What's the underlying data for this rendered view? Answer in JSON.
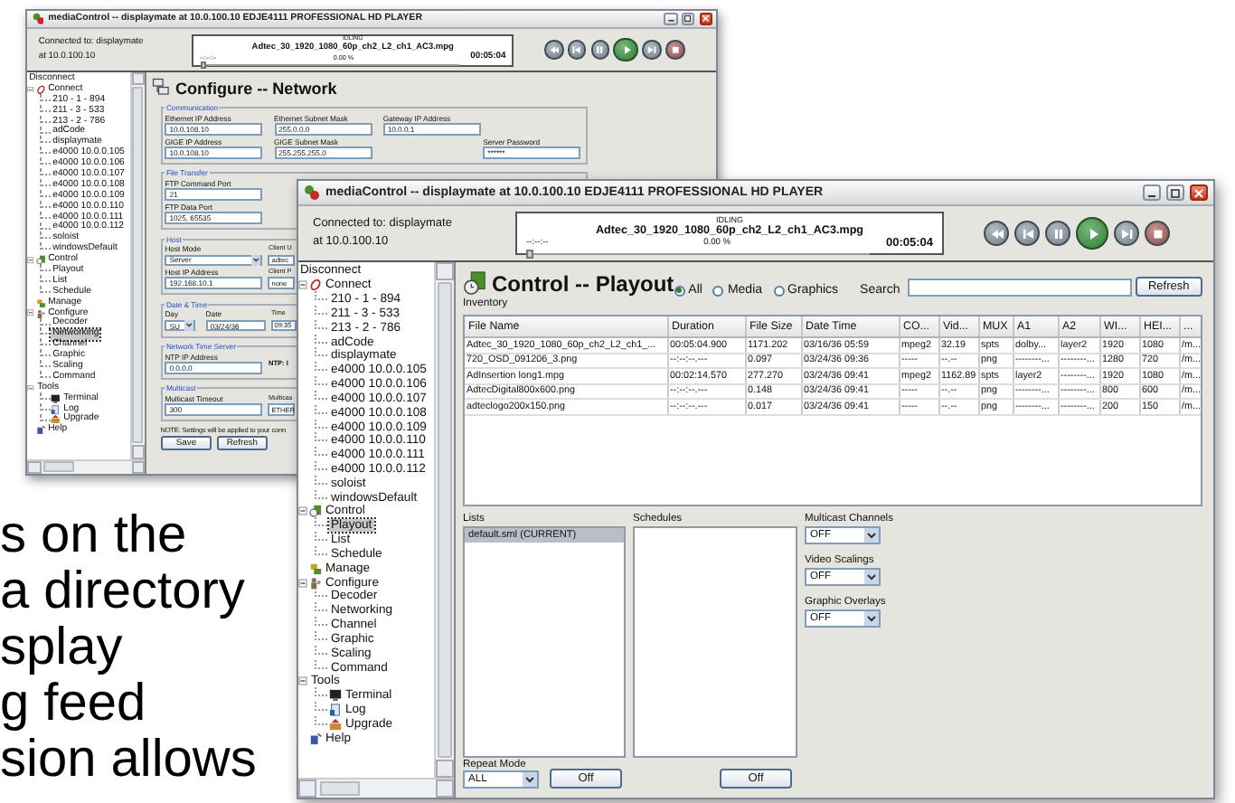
{
  "back_window": {
    "title": "mediaControl -- displaymate at 10.0.100.10 EDJE4111 PROFESSIONAL HD PLAYER",
    "connection": [
      "Connected to: displaymate",
      "at 10.0.100.10"
    ],
    "player": {
      "status": "IDLING",
      "file": "Adtec_30_1920_1080_60p_ch2_L2_ch1_AC3.mpg",
      "percent": "0.00 %",
      "position": "--:--:--",
      "duration": "00:05:04",
      "level": 0
    },
    "tree": [
      {
        "label": "Disconnect",
        "kind": "plain",
        "selected": false
      },
      {
        "label": "Connect",
        "kind": "link",
        "expanded": true,
        "selected": false,
        "children": [
          {
            "label": "210 - 1 - 894",
            "kind": "leaf",
            "selected": false
          },
          {
            "label": "211 - 3 - 533",
            "kind": "leaf",
            "selected": false
          },
          {
            "label": "213 - 2 - 786",
            "kind": "leaf",
            "selected": false
          },
          {
            "label": "adCode",
            "kind": "leaf",
            "selected": false
          },
          {
            "label": "displaymate",
            "kind": "leaf",
            "selected": false
          },
          {
            "label": "e4000 10.0.0.105",
            "kind": "leaf",
            "selected": false
          },
          {
            "label": "e4000 10.0.0.106",
            "kind": "leaf",
            "selected": false
          },
          {
            "label": "e4000 10.0.0.107",
            "kind": "leaf",
            "selected": false
          },
          {
            "label": "e4000 10.0.0.108",
            "kind": "leaf",
            "selected": false
          },
          {
            "label": "e4000 10.0.0.109",
            "kind": "leaf",
            "selected": false
          },
          {
            "label": "e4000 10.0.0.110",
            "kind": "leaf",
            "selected": false
          },
          {
            "label": "e4000 10.0.0.111",
            "kind": "leaf",
            "selected": false
          },
          {
            "label": "e4000 10.0.0.112",
            "kind": "leaf",
            "selected": false
          },
          {
            "label": "soloist",
            "kind": "leaf",
            "selected": false
          },
          {
            "label": "windowsDefault",
            "kind": "leaf",
            "selected": false
          }
        ]
      },
      {
        "label": "Control",
        "kind": "control",
        "expanded": true,
        "selected": false,
        "children": [
          {
            "label": "Playout",
            "kind": "leaf",
            "selected": false
          },
          {
            "label": "List",
            "kind": "leaf",
            "selected": false
          },
          {
            "label": "Schedule",
            "kind": "leaf",
            "selected": false
          }
        ]
      },
      {
        "label": "Manage",
        "kind": "manage",
        "selected": false
      },
      {
        "label": "Configure",
        "kind": "configure",
        "expanded": true,
        "selected": false,
        "children": [
          {
            "label": "Decoder",
            "kind": "leaf",
            "selected": false
          },
          {
            "label": "Networking",
            "kind": "leaf",
            "selected": true
          },
          {
            "label": "Channel",
            "kind": "leaf",
            "selected": false
          },
          {
            "label": "Graphic",
            "kind": "leaf",
            "selected": false
          },
          {
            "label": "Scaling",
            "kind": "leaf",
            "selected": false
          },
          {
            "label": "Command",
            "kind": "leaf",
            "selected": false
          }
        ]
      },
      {
        "label": "Tools",
        "kind": "folder",
        "expanded": true,
        "selected": false,
        "children": [
          {
            "label": "Terminal",
            "kind": "terminal",
            "selected": false
          },
          {
            "label": "Log",
            "kind": "log",
            "selected": false
          },
          {
            "label": "Upgrade",
            "kind": "upgrade",
            "selected": false
          }
        ]
      },
      {
        "label": "Help",
        "kind": "help",
        "selected": false
      }
    ],
    "panel": {
      "kind": "network",
      "title": "Configure -- Network",
      "groups": [
        {
          "legend": "Communication",
          "rows": [
            [
              {
                "label": "Ethernet IP Address",
                "value": "10.0.108.10",
                "kind": "text"
              },
              {
                "label": "Ethernet Subnet Mask",
                "value": "255.0.0.0",
                "kind": "text"
              },
              {
                "label": "Gateway IP Address",
                "value": "10.0.0.1",
                "kind": "text"
              }
            ],
            [
              {
                "label": "GIGE IP Address",
                "value": "10.0.108.10",
                "kind": "text"
              },
              {
                "label": "GIGE Subnet Mask",
                "value": "255.255.255.0",
                "kind": "text"
              },
              {
                "label": "Server Password",
                "value": "******",
                "kind": "password"
              }
            ]
          ]
        },
        {
          "legend": "File Transfer",
          "rows": [
            [
              {
                "label": "FTP Command Port",
                "value": "21",
                "kind": "text"
              }
            ],
            [
              {
                "label": "FTP Data Port",
                "value": "1025, 65535",
                "kind": "text"
              }
            ]
          ]
        },
        {
          "legend": "Host",
          "rows": [
            [
              {
                "label": "Host Mode",
                "value": "Server",
                "kind": "combo"
              },
              {
                "label": "Client U",
                "value": "adtec",
                "kind": "partial"
              }
            ],
            [
              {
                "label": "Host IP Address",
                "value": "192.168.10.1",
                "kind": "text"
              },
              {
                "label": "Client P",
                "value": "none",
                "kind": "partial"
              }
            ]
          ]
        },
        {
          "legend": "Date & Time",
          "rows": [
            [
              {
                "label": "Day",
                "value": "SU",
                "kind": "small-combo"
              },
              {
                "label": "Date",
                "value": "03/24/36",
                "kind": "date"
              },
              {
                "label": "Time",
                "value": "09:35",
                "kind": "partial"
              }
            ]
          ]
        },
        {
          "legend": "Network Time Server",
          "rows": [
            [
              {
                "label": "NTP IP Address",
                "value": "0.0.0.0",
                "kind": "text"
              },
              {
                "label": "NTP: I",
                "kind": "heading"
              }
            ]
          ]
        },
        {
          "legend": "Multicast",
          "rows": [
            [
              {
                "label": "Multicast Timeout",
                "value": "300",
                "kind": "text"
              },
              {
                "label": "Multicas",
                "value": "ETHER",
                "kind": "partial"
              }
            ]
          ]
        }
      ],
      "note": "NOTE: Settings will be applied to your conn",
      "buttons": [
        "Save",
        "Refresh"
      ]
    }
  },
  "front_window": {
    "title": "mediaControl -- displaymate at 10.0.100.10 EDJE4111 PROFESSIONAL HD PLAYER",
    "connection": [
      "Connected to: displaymate",
      "at 10.0.100.10"
    ],
    "player": {
      "status": "IDLING",
      "file": "Adtec_30_1920_1080_60p_ch2_L2_ch1_AC3.mpg",
      "percent": "0.00 %",
      "position": "--:--:--",
      "duration": "00:05:04",
      "level": 0
    },
    "tree": [
      {
        "label": "Disconnect",
        "kind": "plain",
        "selected": false
      },
      {
        "label": "Connect",
        "kind": "link",
        "expanded": true,
        "selected": false,
        "children": [
          {
            "label": "210 - 1 - 894",
            "kind": "leaf",
            "selected": false
          },
          {
            "label": "211 - 3 - 533",
            "kind": "leaf",
            "selected": false
          },
          {
            "label": "213 - 2 - 786",
            "kind": "leaf",
            "selected": false
          },
          {
            "label": "adCode",
            "kind": "leaf",
            "selected": false
          },
          {
            "label": "displaymate",
            "kind": "leaf",
            "selected": false
          },
          {
            "label": "e4000 10.0.0.105",
            "kind": "leaf",
            "selected": false
          },
          {
            "label": "e4000 10.0.0.106",
            "kind": "leaf",
            "selected": false
          },
          {
            "label": "e4000 10.0.0.107",
            "kind": "leaf",
            "selected": false
          },
          {
            "label": "e4000 10.0.0.108",
            "kind": "leaf",
            "selected": false
          },
          {
            "label": "e4000 10.0.0.109",
            "kind": "leaf",
            "selected": false
          },
          {
            "label": "e4000 10.0.0.110",
            "kind": "leaf",
            "selected": false
          },
          {
            "label": "e4000 10.0.0.111",
            "kind": "leaf",
            "selected": false
          },
          {
            "label": "e4000 10.0.0.112",
            "kind": "leaf",
            "selected": false
          },
          {
            "label": "soloist",
            "kind": "leaf",
            "selected": false
          },
          {
            "label": "windowsDefault",
            "kind": "leaf",
            "selected": false
          }
        ]
      },
      {
        "label": "Control",
        "kind": "control",
        "expanded": true,
        "selected": false,
        "children": [
          {
            "label": "Playout",
            "kind": "leaf",
            "selected": true
          },
          {
            "label": "List",
            "kind": "leaf",
            "selected": false
          },
          {
            "label": "Schedule",
            "kind": "leaf",
            "selected": false
          }
        ]
      },
      {
        "label": "Manage",
        "kind": "manage",
        "selected": false
      },
      {
        "label": "Configure",
        "kind": "configure",
        "expanded": true,
        "selected": false,
        "children": [
          {
            "label": "Decoder",
            "kind": "leaf",
            "selected": false
          },
          {
            "label": "Networking",
            "kind": "leaf",
            "selected": false
          },
          {
            "label": "Channel",
            "kind": "leaf",
            "selected": false
          },
          {
            "label": "Graphic",
            "kind": "leaf",
            "selected": false
          },
          {
            "label": "Scaling",
            "kind": "leaf",
            "selected": false
          },
          {
            "label": "Command",
            "kind": "leaf",
            "selected": false
          }
        ]
      },
      {
        "label": "Tools",
        "kind": "folder",
        "expanded": true,
        "selected": false,
        "children": [
          {
            "label": "Terminal",
            "kind": "terminal",
            "selected": false
          },
          {
            "label": "Log",
            "kind": "log",
            "selected": false
          },
          {
            "label": "Upgrade",
            "kind": "upgrade",
            "selected": false
          }
        ]
      },
      {
        "label": "Help",
        "kind": "help",
        "selected": false
      }
    ],
    "panel": {
      "kind": "playout",
      "title": "Control -- Playout",
      "inventory_label": "Inventory",
      "filters": [
        {
          "label": "All",
          "selected": true
        },
        {
          "label": "Media",
          "selected": false
        },
        {
          "label": "Graphics",
          "selected": false
        }
      ],
      "search": {
        "label": "Search"
      },
      "refresh": "Refresh",
      "table": {
        "columns": [
          "File Name",
          "Duration",
          "File Size",
          "Date Time",
          "CO...",
          "Vid...",
          "MUX",
          "A1",
          "A2",
          "WI...",
          "HEI...",
          "..."
        ],
        "rows": [
          [
            "Adtec_30_1920_1080_60p_ch2_L2_ch1_...",
            "00:05:04.900",
            "1171.202",
            "03/16/36 05:59",
            "mpeg2",
            "32.19",
            "spts",
            "dolby...",
            "layer2",
            "1920",
            "1080",
            "/m..."
          ],
          [
            "720_OSD_091206_3.png",
            "--:--:--.---",
            "0.097",
            "03/24/36 09:36",
            "-----",
            "--.--",
            "png",
            "--------...",
            "--------...",
            "1280",
            "720",
            "/m..."
          ],
          [
            "AdInsertion long1.mpg",
            "00:02:14.570",
            "277.270",
            "03/24/36 09:41",
            "mpeg2",
            "1162.89",
            "spts",
            "layer2",
            "--------...",
            "1920",
            "1080",
            "/m..."
          ],
          [
            "AdtecDigital800x600.png",
            "--:--:--.---",
            "0.148",
            "03/24/36 09:41",
            "-----",
            "--.--",
            "png",
            "--------...",
            "--------...",
            "800",
            "600",
            "/m..."
          ],
          [
            "adteclogo200x150.png",
            "--:--:--.---",
            "0.017",
            "03/24/36 09:41",
            "-----",
            "--.--",
            "png",
            "--------...",
            "--------...",
            "200",
            "150",
            "/m..."
          ]
        ]
      },
      "lists": {
        "label": "Lists",
        "items": [
          {
            "label": "default.sml (CURRENT)",
            "selected": true
          }
        ]
      },
      "schedules": {
        "label": "Schedules"
      },
      "dropdowns": [
        {
          "label": "Multicast Channels",
          "value": "OFF"
        },
        {
          "label": "Video Scalings",
          "value": "OFF"
        },
        {
          "label": "Graphic Overlays",
          "value": "OFF"
        }
      ],
      "repeat_mode": {
        "label": "Repeat Mode",
        "value": "ALL"
      },
      "off_buttons": [
        "Off",
        "Off"
      ]
    }
  },
  "slide_text": [
    "s on the",
    "a directory",
    "splay",
    "g feed",
    "sion allows"
  ]
}
